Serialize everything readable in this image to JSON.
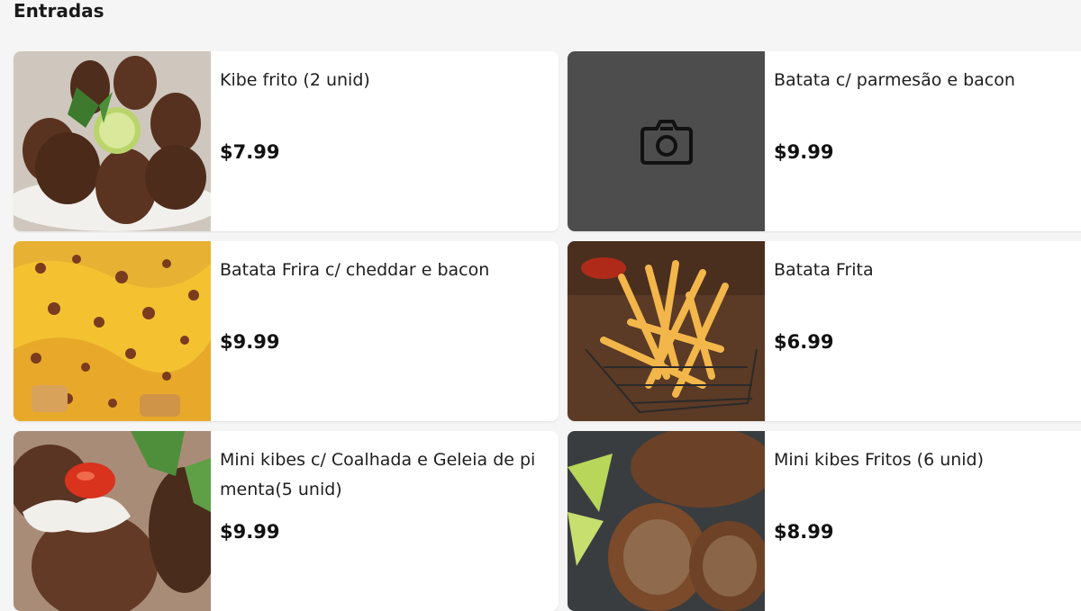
{
  "section": {
    "title": "Entradas"
  },
  "items": [
    {
      "name": "Kibe frito (2 unid)",
      "price": "$7.99",
      "image": "kibe-photo"
    },
    {
      "name": "Batata c/ parmesão e bacon",
      "price": "$9.99",
      "image": "camera-icon"
    },
    {
      "name": "Batata Frira c/ cheddar e bacon",
      "price": "$9.99",
      "image": "cheddar-fries-photo"
    },
    {
      "name": "Batata Frita",
      "price": "$6.99",
      "image": "fries-basket-photo"
    },
    {
      "name": "Mini kibes c/ Coalhada e Geleia de pimenta(5 unid)",
      "price": "$9.99",
      "image": "mini-kibes-photo"
    },
    {
      "name": "Mini kibes Fritos (6 unid)",
      "price": "$8.99",
      "image": "fried-mini-kibes-photo"
    }
  ],
  "colors": {
    "background": "#f5f5f5",
    "card": "#ffffff",
    "placeholder": "#4d4d4d"
  }
}
